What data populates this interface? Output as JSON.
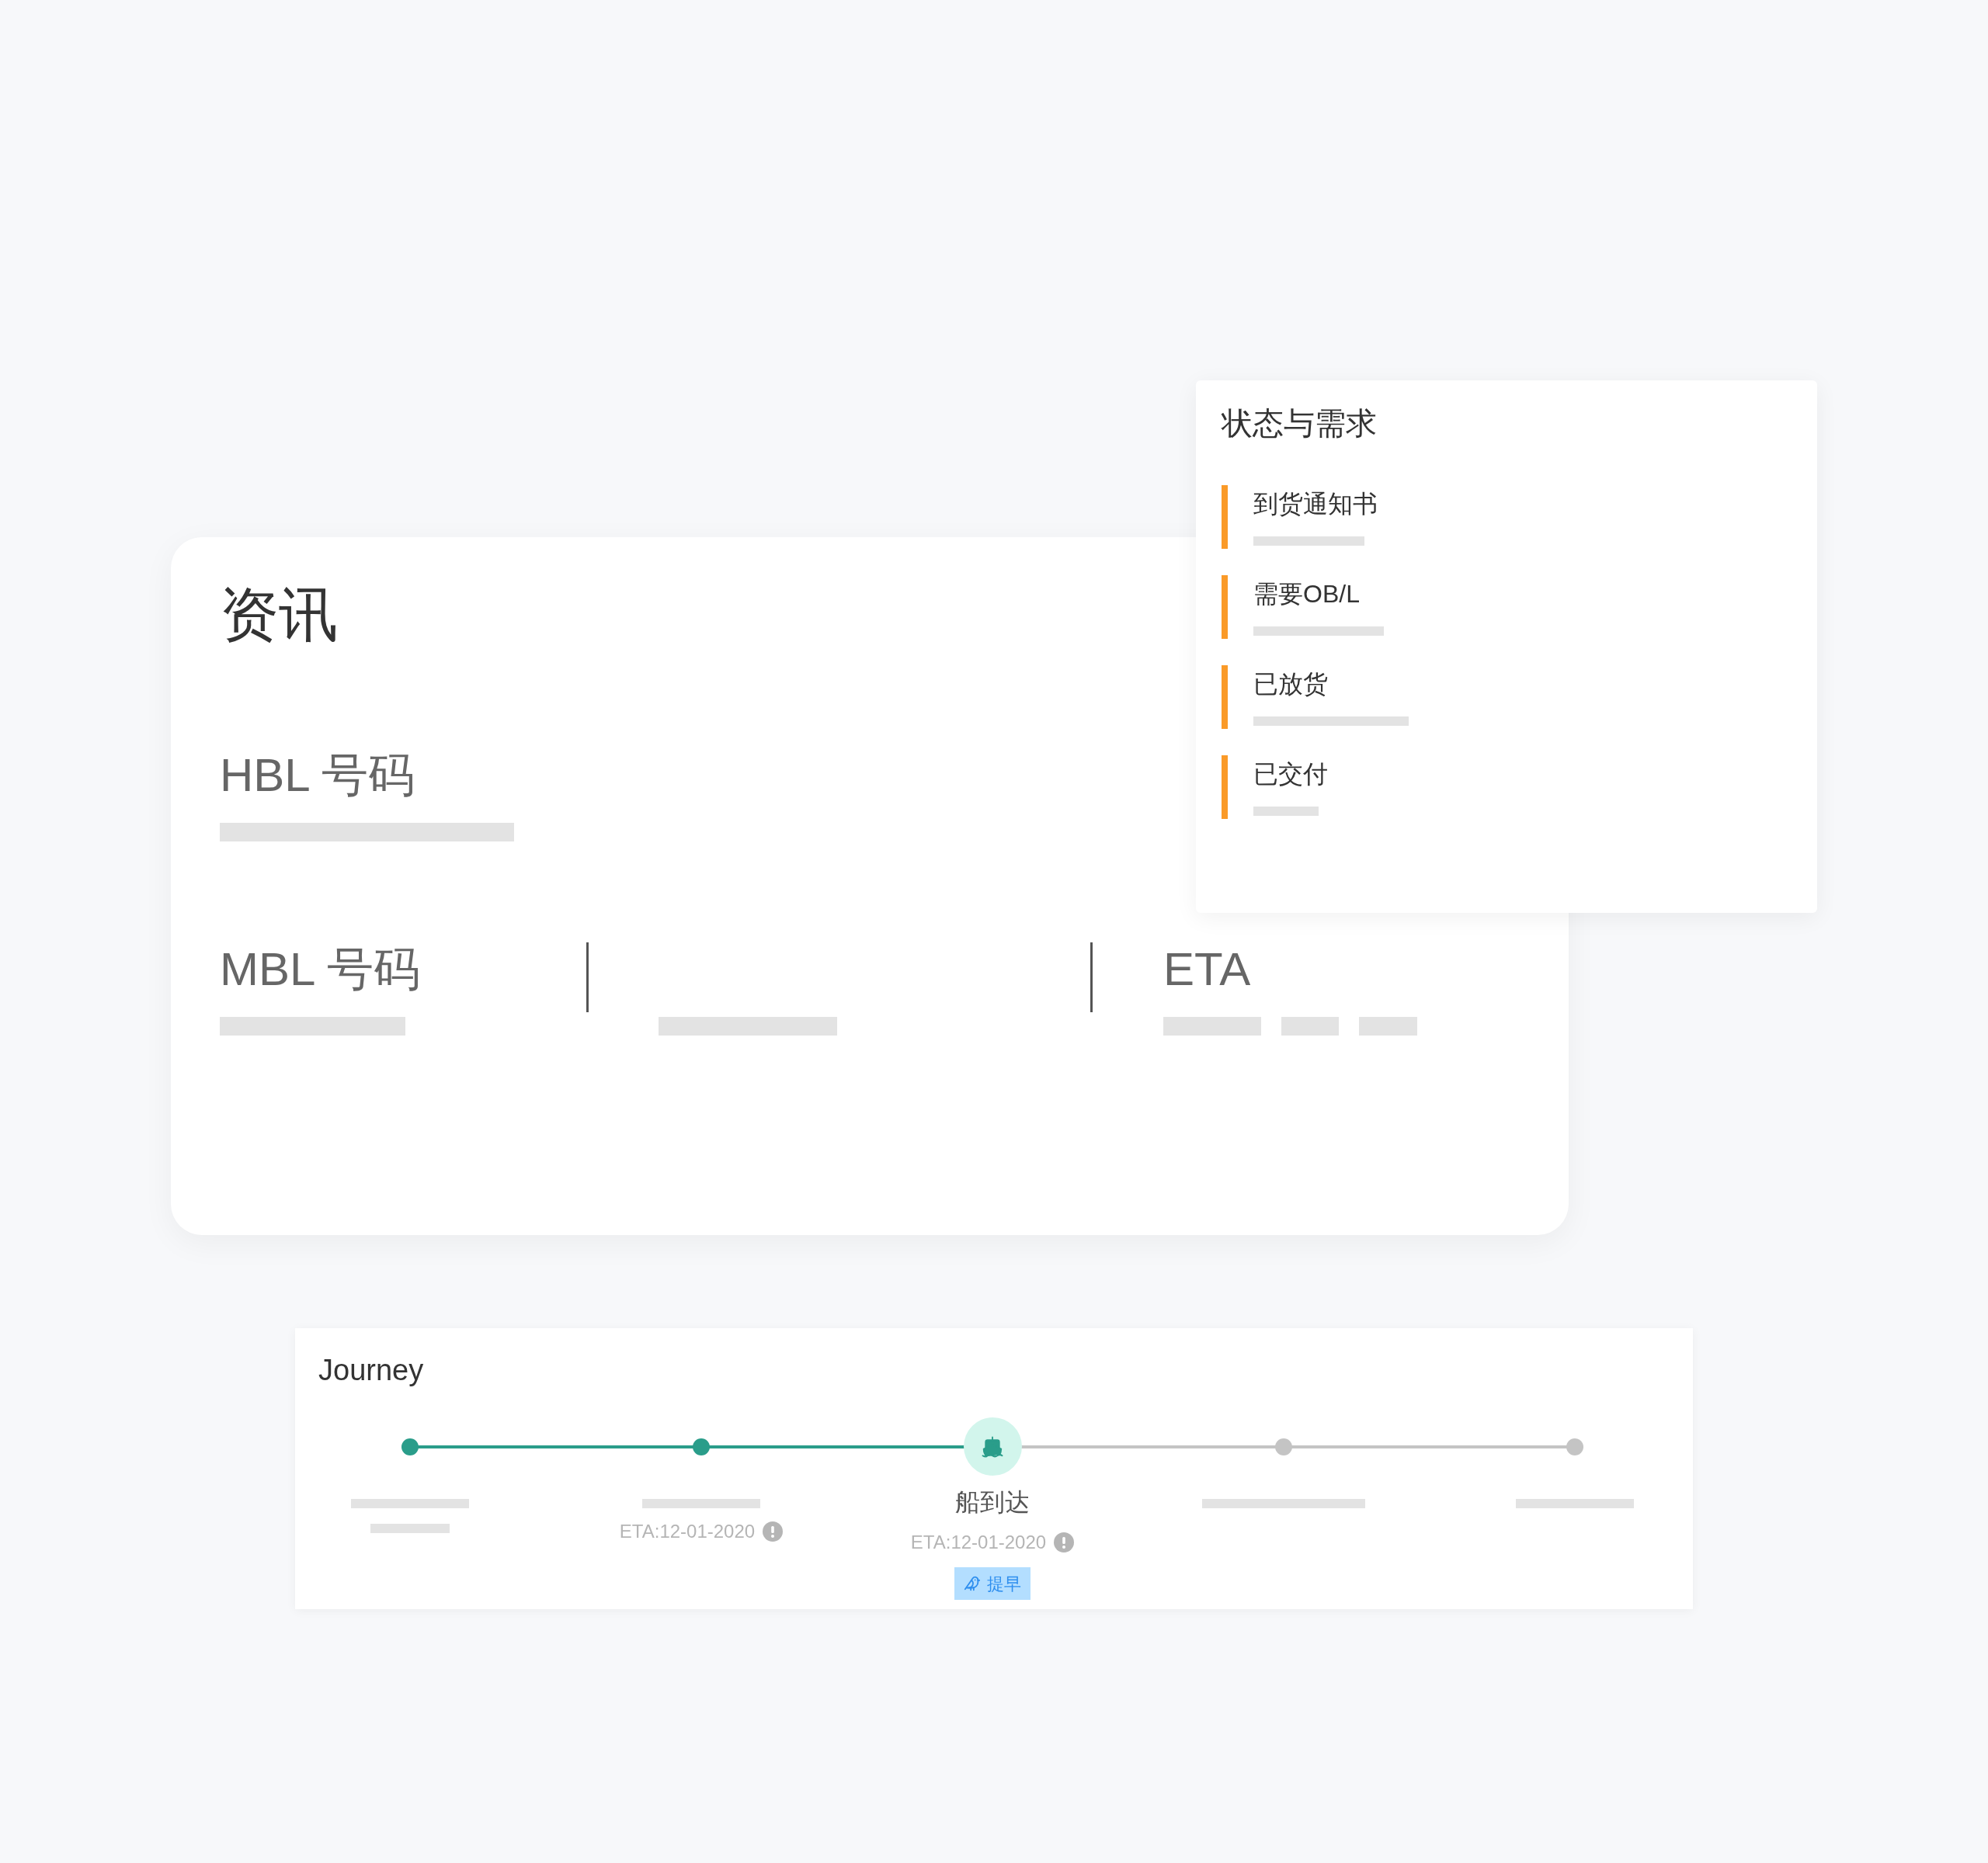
{
  "info_card": {
    "title": "资讯",
    "hbl_label": "HBL 号码",
    "mbl_label": "MBL 号码",
    "eta_label": "ETA"
  },
  "status_card": {
    "title": "状态与需求",
    "items": [
      {
        "label": "到货通知书"
      },
      {
        "label": "需要OB/L"
      },
      {
        "label": "已放货"
      },
      {
        "label": "已交付"
      }
    ]
  },
  "journey": {
    "title": "Journey",
    "stops": [
      {
        "kind": "done"
      },
      {
        "kind": "done",
        "eta": "ETA:12-01-2020"
      },
      {
        "kind": "current",
        "label": "船到达",
        "eta": "ETA:12-01-2020",
        "badge": "提早"
      },
      {
        "kind": "pending"
      },
      {
        "kind": "pending"
      }
    ]
  }
}
